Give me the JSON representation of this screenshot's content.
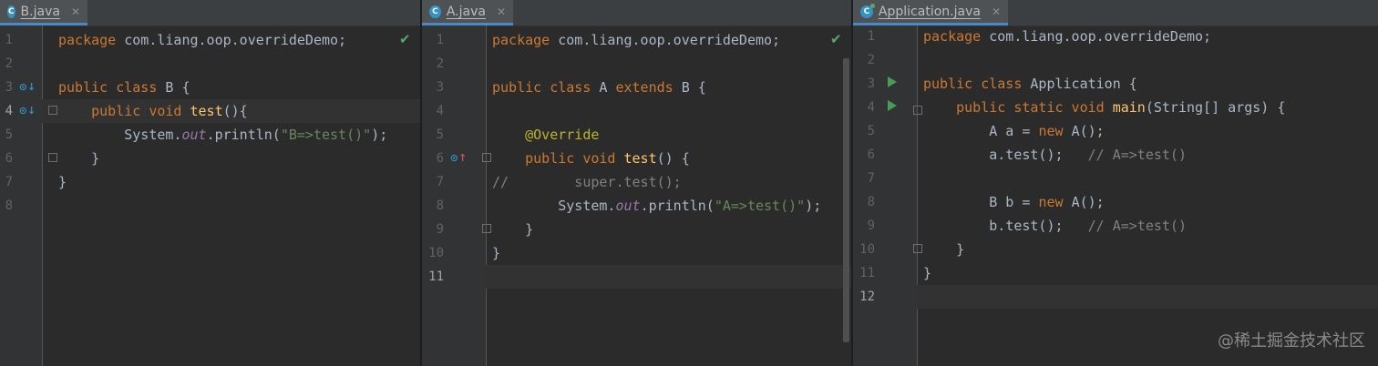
{
  "panes": [
    {
      "tab": "B.java",
      "lines": [
        [
          [
            "kw",
            "package "
          ],
          [
            "t",
            "com.liang.oop.overrideDemo;"
          ]
        ],
        [],
        [
          [
            "kw",
            "public class "
          ],
          [
            "t",
            "B {"
          ]
        ],
        [
          [
            "t",
            "    "
          ],
          [
            "kw",
            "public void "
          ],
          [
            "fn",
            "test"
          ],
          [
            "t",
            "(){"
          ]
        ],
        [
          [
            "t",
            "        System."
          ],
          [
            "ital",
            "out"
          ],
          [
            "t",
            ".println("
          ],
          [
            "str",
            "\"B=>test()\""
          ],
          [
            "t",
            ");"
          ]
        ],
        [
          [
            "t",
            "    }"
          ]
        ],
        [
          [
            "t",
            "}"
          ]
        ],
        []
      ]
    },
    {
      "tab": "A.java",
      "lines": [
        [
          [
            "kw",
            "package "
          ],
          [
            "t",
            "com.liang.oop.overrideDemo;"
          ]
        ],
        [],
        [
          [
            "kw",
            "public class "
          ],
          [
            "t",
            "A "
          ],
          [
            "kw",
            "extends "
          ],
          [
            "t",
            "B {"
          ]
        ],
        [],
        [
          [
            "t",
            "    "
          ],
          [
            "ann",
            "@Override"
          ]
        ],
        [
          [
            "t",
            "    "
          ],
          [
            "kw",
            "public void "
          ],
          [
            "fn",
            "test"
          ],
          [
            "t",
            "() {"
          ]
        ],
        [
          [
            "cmt",
            "//        super.test();"
          ]
        ],
        [
          [
            "t",
            "        System."
          ],
          [
            "ital",
            "out"
          ],
          [
            "t",
            ".println("
          ],
          [
            "str",
            "\"A=>test()\""
          ],
          [
            "t",
            ");"
          ]
        ],
        [
          [
            "t",
            "    }"
          ]
        ],
        [
          [
            "t",
            "}"
          ]
        ],
        []
      ]
    },
    {
      "tab": "Application.java",
      "lines": [
        [
          [
            "kw",
            "package "
          ],
          [
            "t",
            "com.liang.oop.overrideDemo;"
          ]
        ],
        [],
        [
          [
            "kw",
            "public class "
          ],
          [
            "t",
            "Application {"
          ]
        ],
        [
          [
            "t",
            "    "
          ],
          [
            "kw",
            "public static void "
          ],
          [
            "fn",
            "main"
          ],
          [
            "t",
            "(String[] args) {"
          ]
        ],
        [
          [
            "t",
            "        A a = "
          ],
          [
            "kw",
            "new "
          ],
          [
            "t",
            "A();"
          ]
        ],
        [
          [
            "t",
            "        a.test();   "
          ],
          [
            "cmt",
            "// A=>test()"
          ]
        ],
        [],
        [
          [
            "t",
            "        B b = "
          ],
          [
            "kw",
            "new "
          ],
          [
            "t",
            "A();"
          ]
        ],
        [
          [
            "t",
            "        b.test();   "
          ],
          [
            "cmt",
            "// A=>test()"
          ]
        ],
        [
          [
            "t",
            "    }"
          ]
        ],
        [
          [
            "t",
            "}"
          ]
        ],
        []
      ]
    }
  ],
  "icons": {
    "file_icon": "c-class-icon",
    "check": "✔",
    "close": "✕"
  },
  "watermark": "@稀土掘金技术社区"
}
